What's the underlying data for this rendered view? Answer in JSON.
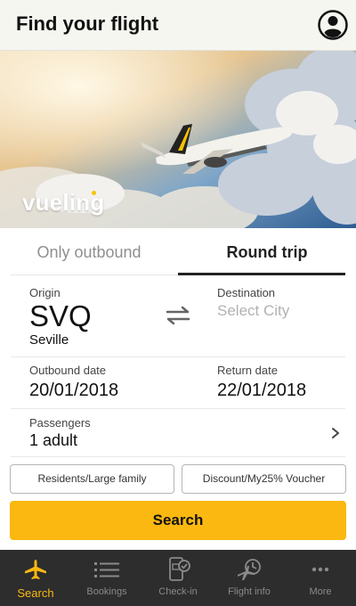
{
  "header": {
    "title": "Find your flight",
    "profile_icon": "user-circle-icon"
  },
  "hero": {
    "brand": "vueling",
    "image": "airplane-above-clouds"
  },
  "tabs": [
    {
      "label": "Only outbound",
      "active": false
    },
    {
      "label": "Round trip",
      "active": true
    }
  ],
  "origin": {
    "label": "Origin",
    "code": "SVQ",
    "city": "Seville"
  },
  "destination": {
    "label": "Destination",
    "placeholder": "Select City"
  },
  "swap_icon": "swap-arrows-icon",
  "dates": {
    "outbound_label": "Outbound date",
    "outbound_value": "20/01/2018",
    "return_label": "Return date",
    "return_value": "22/01/2018"
  },
  "passengers": {
    "label": "Passengers",
    "value": "1 adult"
  },
  "options": {
    "residents": "Residents/Large family",
    "voucher": "Discount/My25% Voucher"
  },
  "search_button": "Search",
  "bottom_nav": [
    {
      "label": "Search",
      "icon": "airplane-icon",
      "active": true
    },
    {
      "label": "Bookings",
      "icon": "list-icon",
      "active": false
    },
    {
      "label": "Check-in",
      "icon": "phone-checkin-icon",
      "active": false
    },
    {
      "label": "Flight info",
      "icon": "plane-clock-icon",
      "active": false
    },
    {
      "label": "More",
      "icon": "more-dots-icon",
      "active": false
    }
  ],
  "colors": {
    "accent": "#fbb810",
    "nav_bg": "#2d2d2d",
    "header_bg": "#f6f6f0"
  }
}
